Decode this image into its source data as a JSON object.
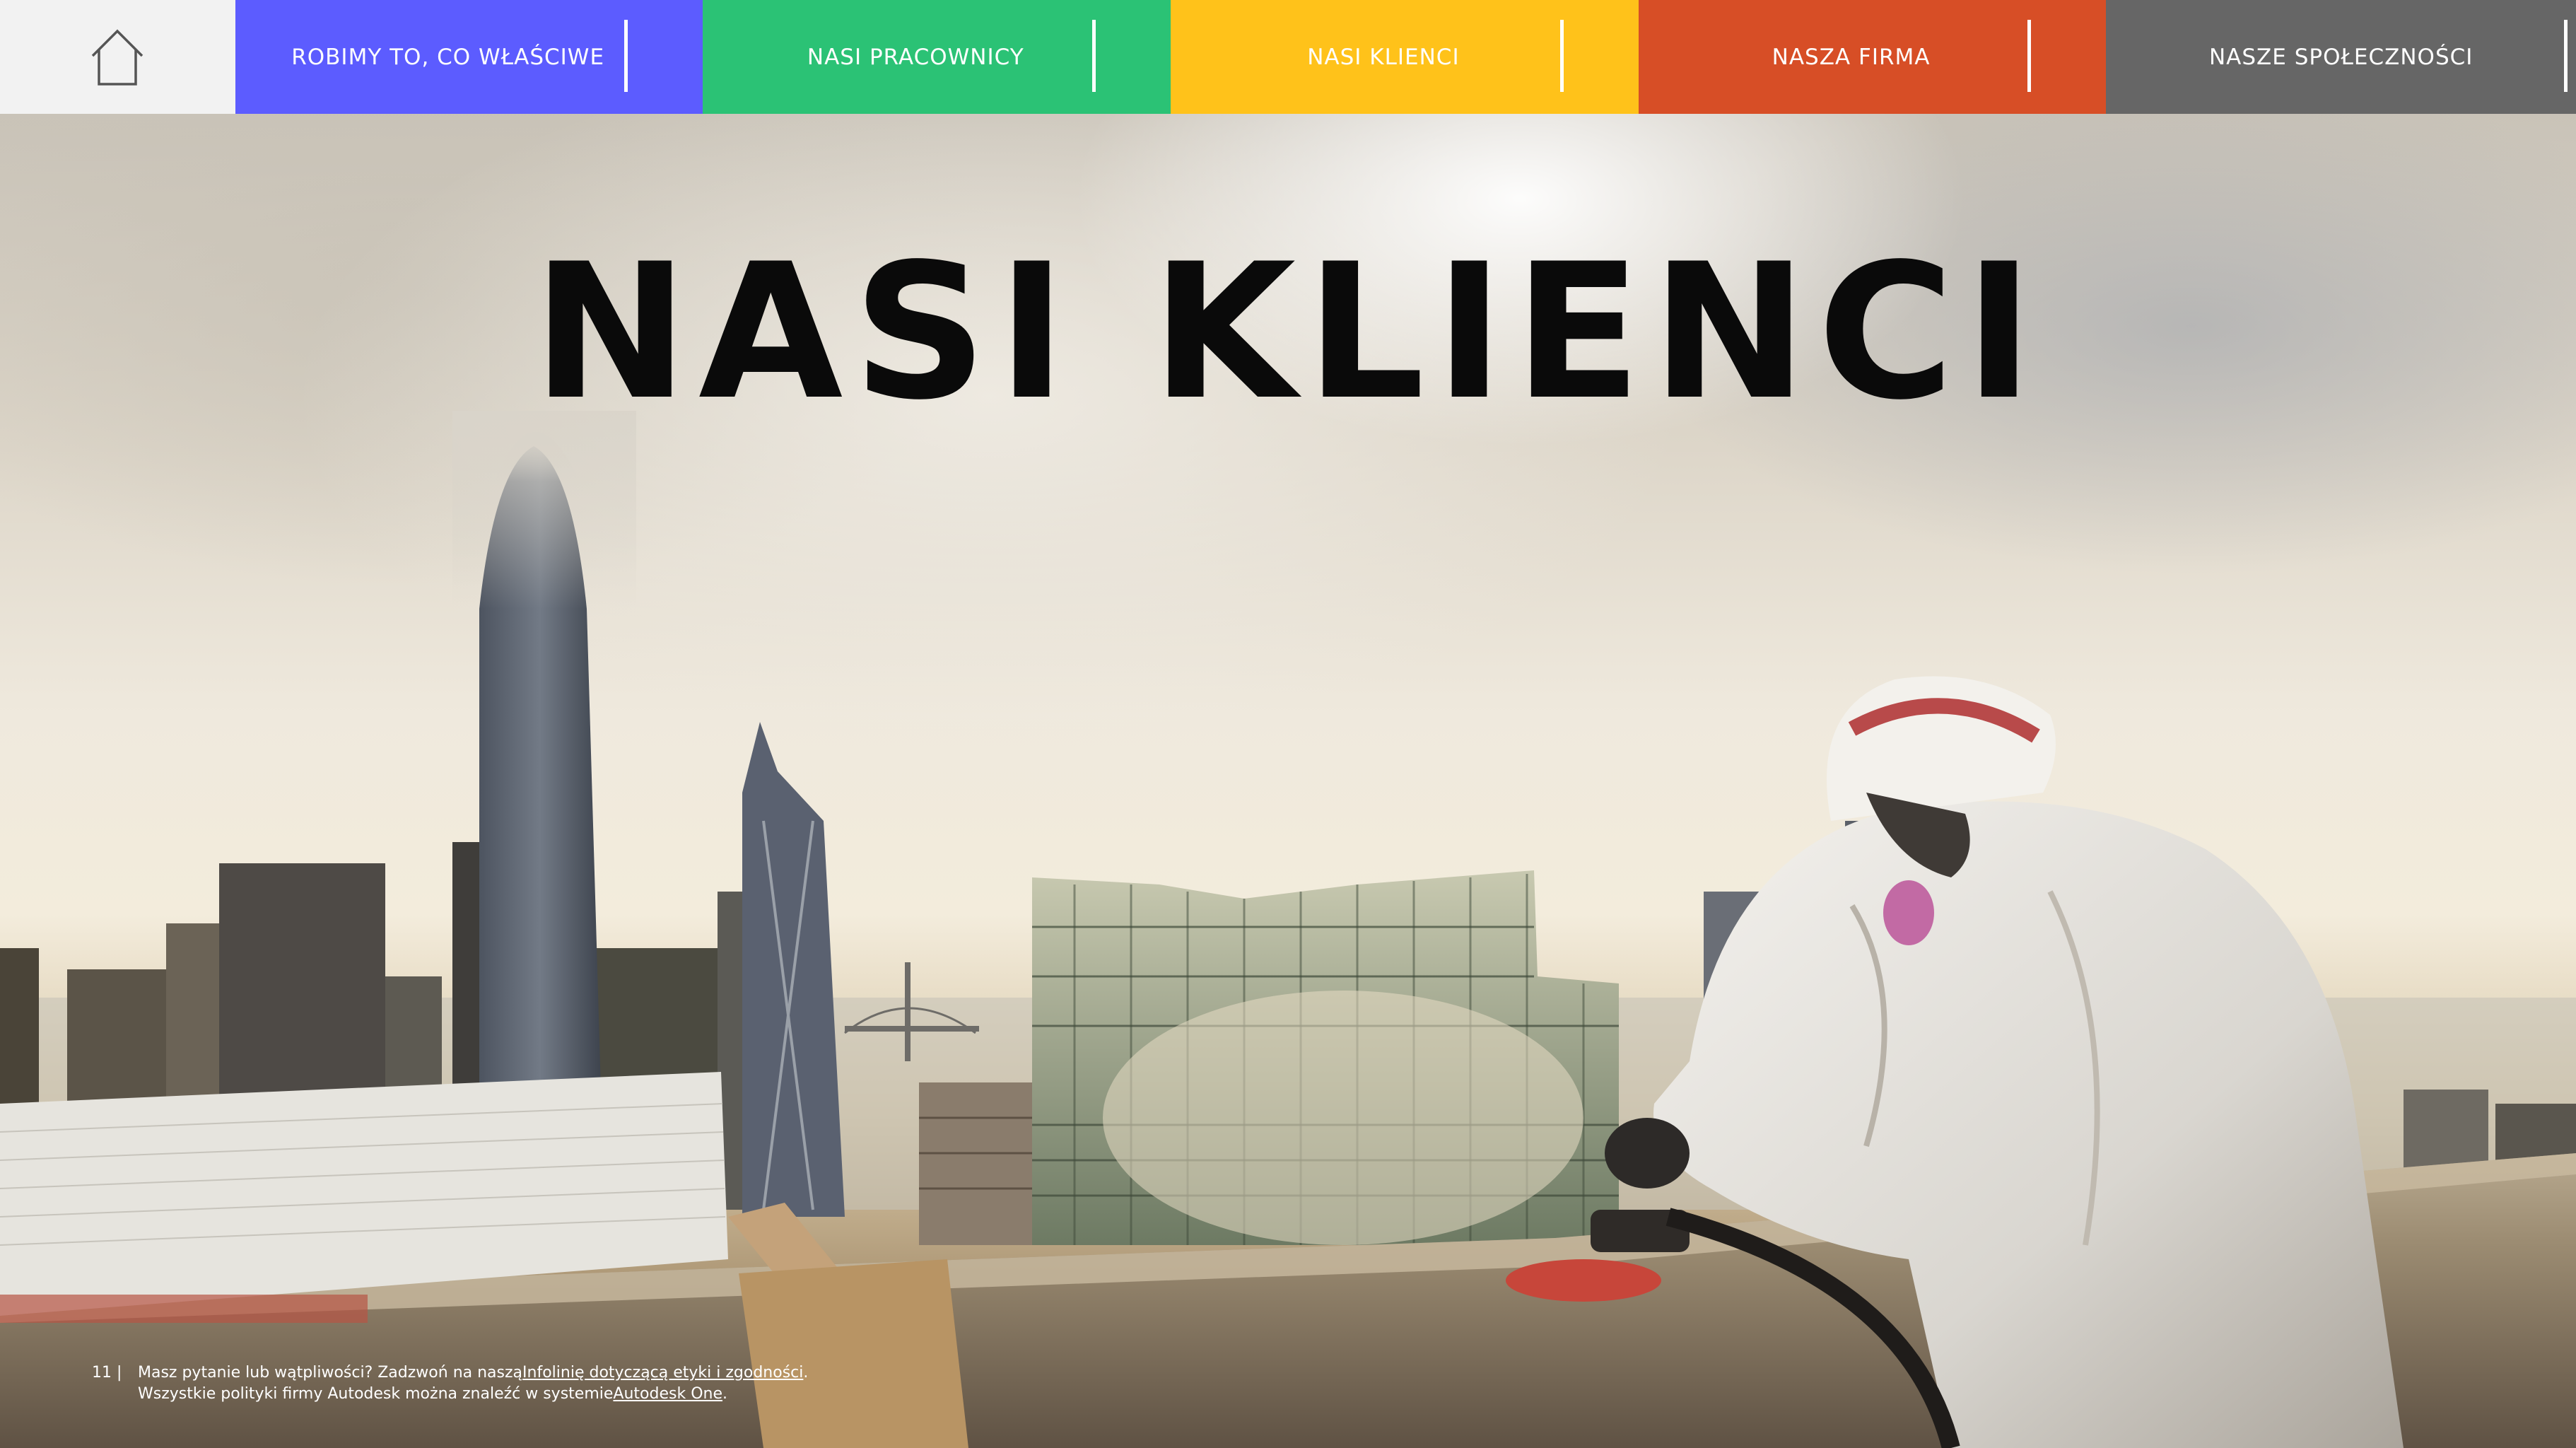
{
  "nav": {
    "home_icon": "home-icon",
    "tabs": [
      {
        "label": "ROBIMY TO, CO WŁAŚCIWE",
        "color": "#5c5cff"
      },
      {
        "label": "NASI PRACOWNICY",
        "color": "#2bc275"
      },
      {
        "label": "NASI KLIENCI",
        "color": "#ffc21a"
      },
      {
        "label": "NASZA FIRMA",
        "color": "#d74e26"
      },
      {
        "label": "NASZE SPOŁECZNOŚCI",
        "color": "#666666"
      }
    ]
  },
  "hero": {
    "title": "NASI KLIENCI"
  },
  "footer": {
    "page_number": "11 |",
    "line1_text": "Masz pytanie lub wątpliwości? Zadzwoń na naszą ",
    "line1_link": "Infolinię dotyczącą etyki i zgodności",
    "line1_end": ".",
    "line2_text": "Wszystkie polityki firmy Autodesk można znaleźć w systemie ",
    "line2_link": "Autodesk One",
    "line2_end": "."
  }
}
